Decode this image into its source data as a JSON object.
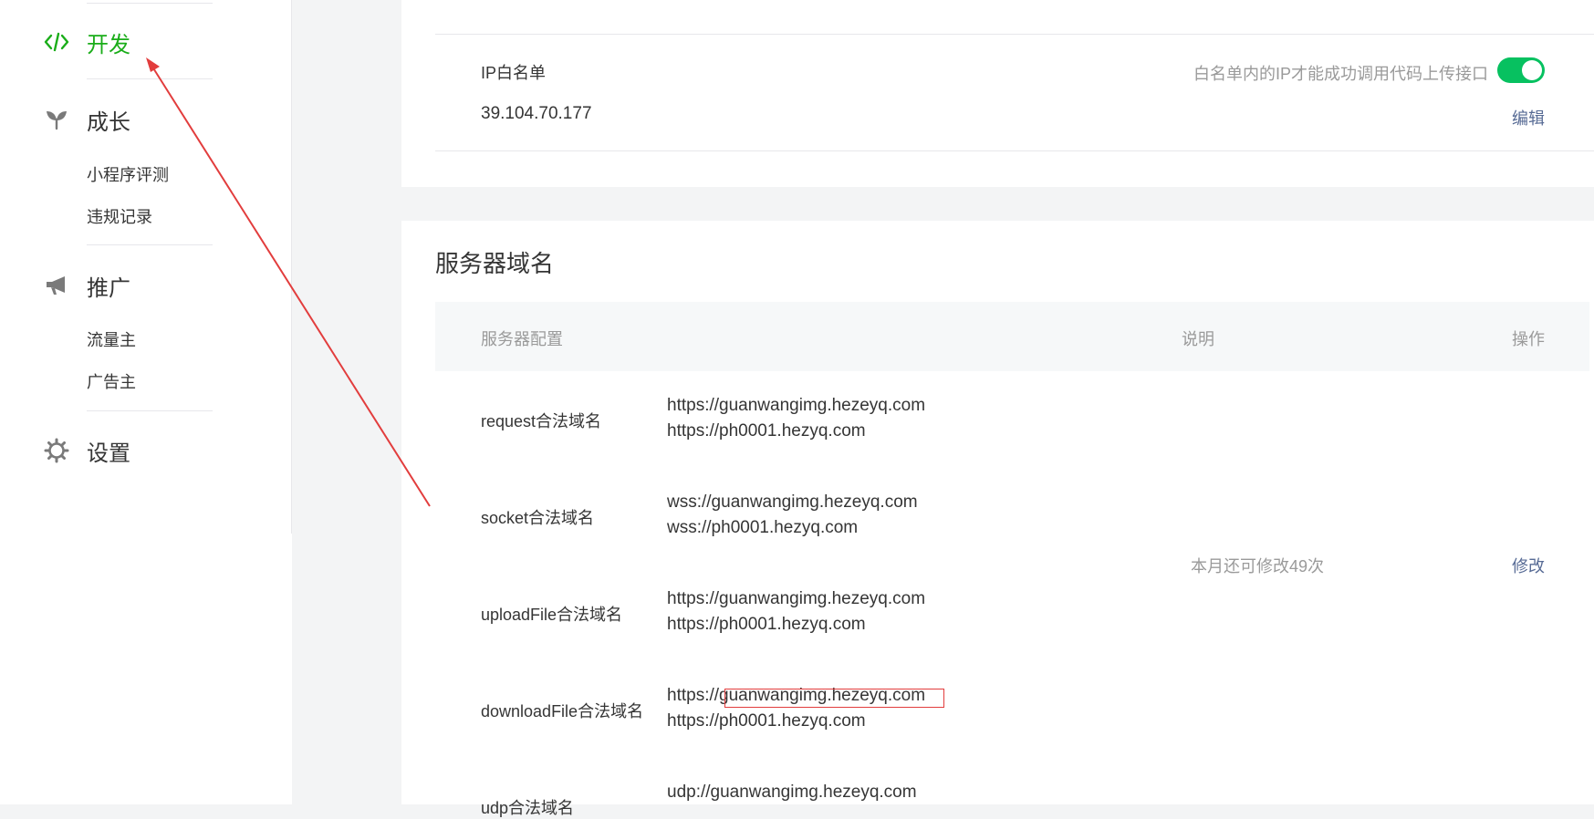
{
  "sidebar": {
    "dev": {
      "label": "开发",
      "icon": "code-icon"
    },
    "growth": {
      "label": "成长",
      "icon": "sprout-icon",
      "items": [
        "小程序评测",
        "违规记录"
      ]
    },
    "promotion": {
      "label": "推广",
      "icon": "megaphone-icon",
      "items": [
        "流量主",
        "广告主"
      ]
    },
    "settings": {
      "label": "设置",
      "icon": "gear-icon"
    }
  },
  "ip_whitelist": {
    "title": "IP白名单",
    "ip": "39.104.70.177",
    "hint": "白名单内的IP才能成功调用代码上传接口",
    "toggle_on": true,
    "edit_label": "编辑"
  },
  "server_domains": {
    "title": "服务器域名",
    "columns": {
      "config": "服务器配置",
      "desc": "说明",
      "op": "操作"
    },
    "rows": [
      {
        "label": "request合法域名",
        "urls": [
          "https://guanwangimg.hezeyq.com",
          "https://ph0001.hezyq.com"
        ]
      },
      {
        "label": "socket合法域名",
        "urls": [
          "wss://guanwangimg.hezeyq.com",
          "wss://ph0001.hezyq.com"
        ]
      },
      {
        "label": "uploadFile合法域名",
        "urls": [
          "https://guanwangimg.hezeyq.com",
          "https://ph0001.hezyq.com"
        ]
      },
      {
        "label": "downloadFile合法域名",
        "urls": [
          "https://guanwangimg.hezeyq.com",
          "https://ph0001.hezyq.com"
        ]
      },
      {
        "label": "udp合法域名",
        "urls": [
          "udp://guanwangimg.hezeyq.com"
        ]
      }
    ],
    "remaining": "本月还可修改49次",
    "modify_label": "修改"
  },
  "colors": {
    "accent_green": "#1aad19",
    "toggle_green": "#07c160",
    "link_blue": "#576b95",
    "annotation_red": "#e23d3d"
  }
}
